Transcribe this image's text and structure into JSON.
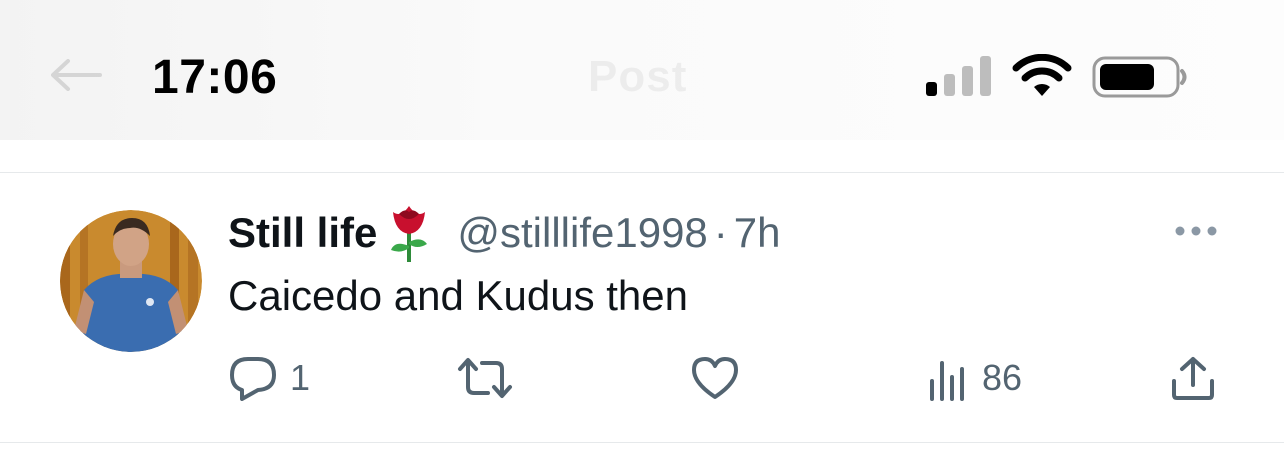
{
  "status_bar": {
    "time": "17:06",
    "icons": [
      "signal-icon",
      "wifi-icon",
      "battery-icon"
    ]
  },
  "nav": {
    "title": "Post",
    "back_icon": "back-arrow-icon"
  },
  "tweet": {
    "display_name": "Still life",
    "name_emoji": "rose-icon",
    "handle": "@stilllife1998",
    "separator": "·",
    "time": "7h",
    "text": "Caicedo and Kudus then",
    "more_icon": "more-icon",
    "actions": {
      "reply": {
        "icon": "reply-icon",
        "count": "1"
      },
      "retweet": {
        "icon": "retweet-icon",
        "count": ""
      },
      "like": {
        "icon": "heart-icon",
        "count": ""
      },
      "views": {
        "icon": "views-icon",
        "count": "86"
      },
      "share": {
        "icon": "share-icon"
      }
    }
  },
  "colors": {
    "text_primary": "#0f1419",
    "text_secondary": "#536471",
    "divider": "#e6e9eb"
  }
}
